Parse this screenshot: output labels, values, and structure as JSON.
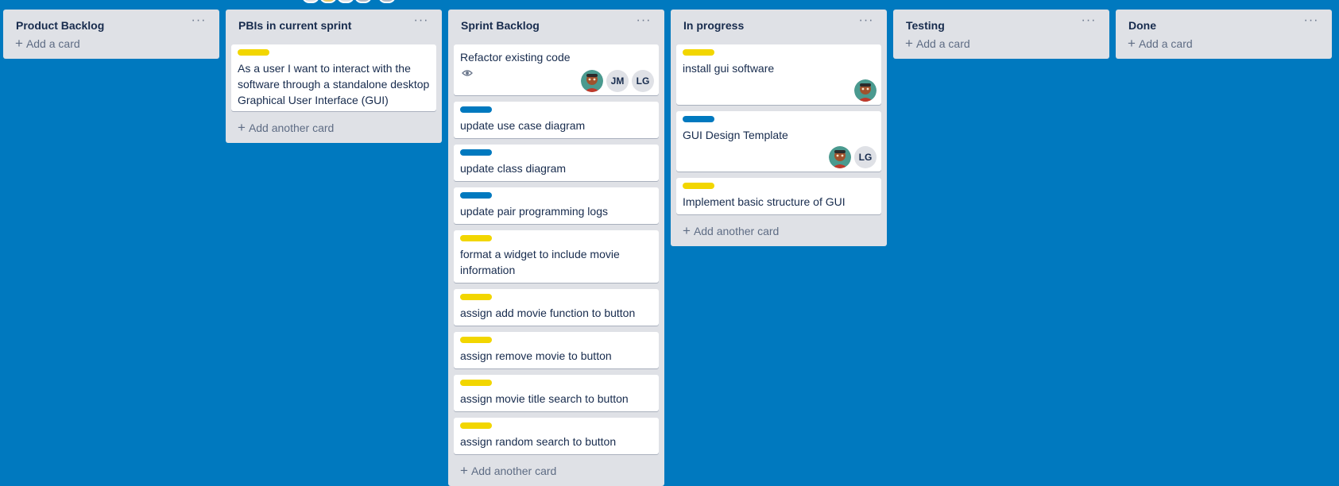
{
  "colors": {
    "board_bg": "#0079bf",
    "list_bg": "#dfe1e6",
    "label_yellow": "#f2d600",
    "label_blue": "#0079bf"
  },
  "add_card": "Add a card",
  "add_another_card": "Add another card",
  "lists": [
    {
      "title": "Product Backlog",
      "cards": []
    },
    {
      "title": "PBIs in current sprint",
      "cards": [
        {
          "label": "yellow",
          "title": "As a user I want to interact with the software through a standalone desktop Graphical User Interface (GUI)"
        }
      ]
    },
    {
      "title": "Sprint Backlog",
      "cards": [
        {
          "label": "",
          "title": "Refactor existing code",
          "badges": [
            "eye-icon"
          ],
          "members": [
            "photo-avatar",
            "JM",
            "LG"
          ]
        },
        {
          "label": "blue",
          "title": "update use case diagram"
        },
        {
          "label": "blue",
          "title": "update class diagram"
        },
        {
          "label": "blue",
          "title": "update pair programming logs"
        },
        {
          "label": "yellow",
          "title": "format a widget to include movie information"
        },
        {
          "label": "yellow",
          "title": "assign add movie function to button"
        },
        {
          "label": "yellow",
          "title": "assign remove movie to button"
        },
        {
          "label": "yellow",
          "title": "assign movie title search to button"
        },
        {
          "label": "yellow",
          "title": "assign random search to button"
        }
      ]
    },
    {
      "title": "In progress",
      "cards": [
        {
          "label": "yellow",
          "title": "install gui software",
          "members": [
            "photo-avatar"
          ]
        },
        {
          "label": "blue",
          "title": "GUI Design Template",
          "members": [
            "photo-avatar",
            "LG"
          ]
        },
        {
          "label": "yellow",
          "title": "Implement basic structure of GUI"
        }
      ]
    },
    {
      "title": "Testing",
      "cards": []
    },
    {
      "title": "Done",
      "cards": []
    }
  ]
}
